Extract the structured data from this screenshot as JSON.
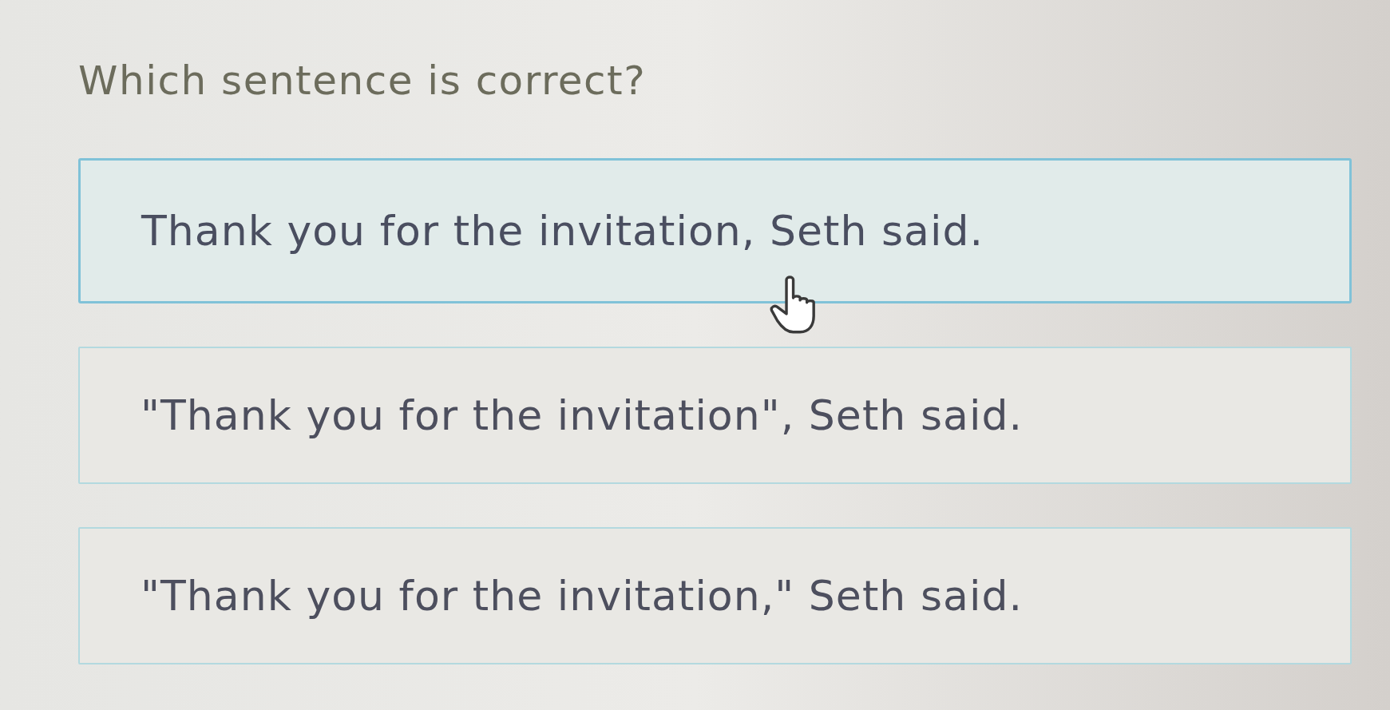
{
  "question": "Which sentence is correct?",
  "options": [
    {
      "text": "Thank you for the invitation, Seth said.",
      "hovered": true
    },
    {
      "text": "\"Thank you for the invitation\", Seth said.",
      "hovered": false
    },
    {
      "text": "\"Thank you for the invitation,\" Seth said.",
      "hovered": false
    }
  ]
}
